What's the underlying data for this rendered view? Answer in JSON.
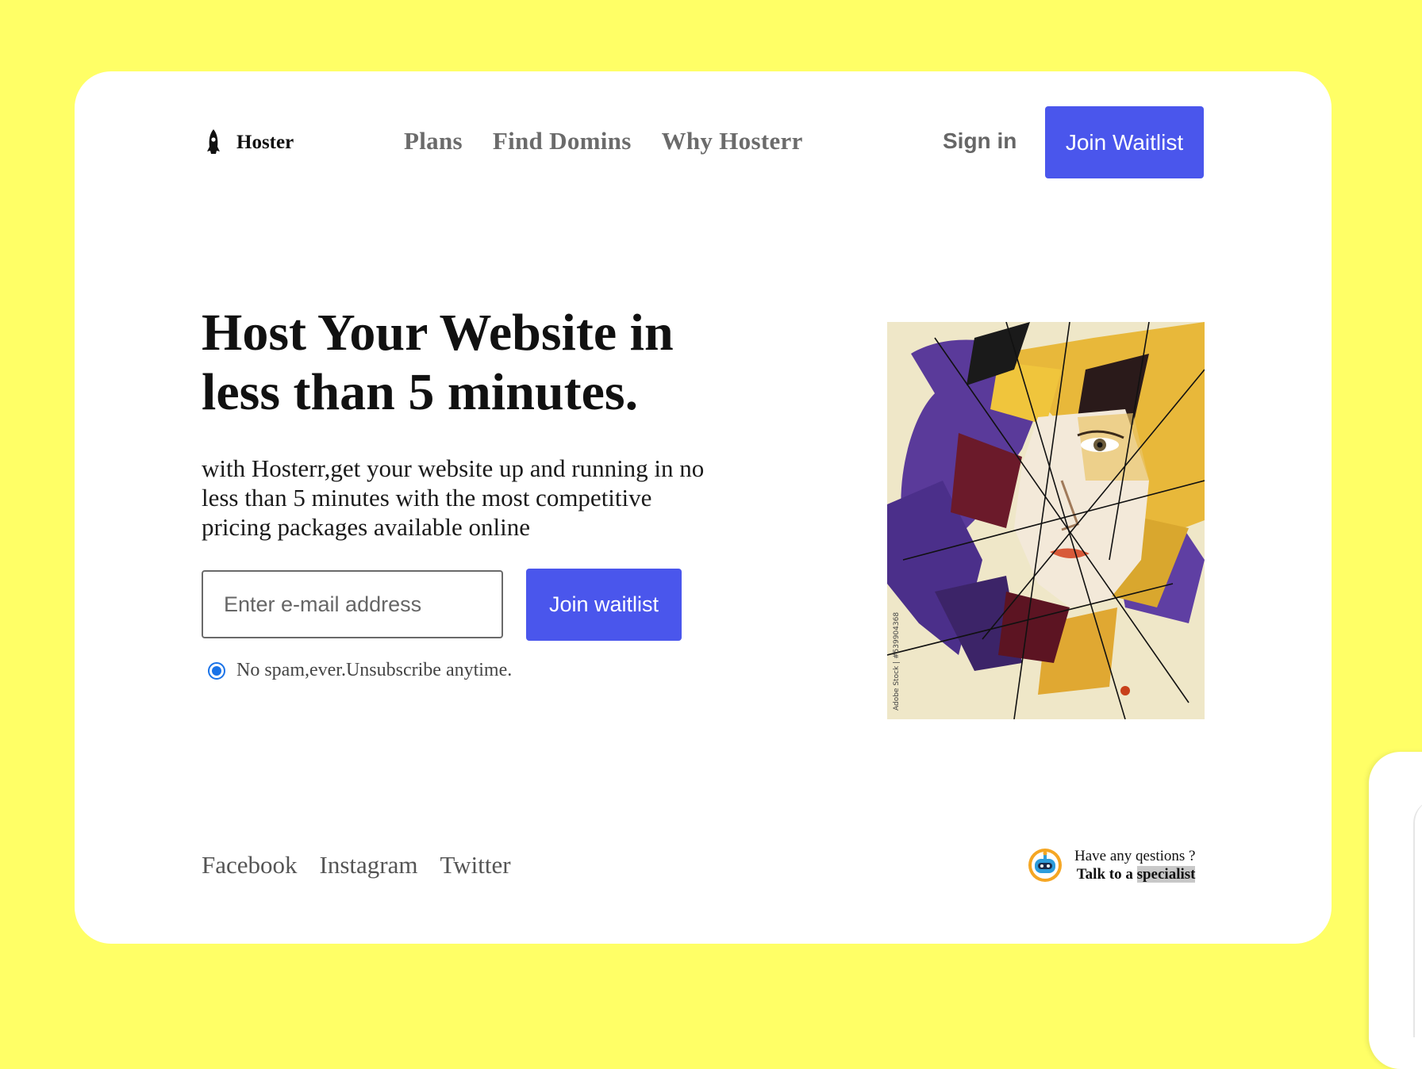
{
  "brand": {
    "name": "Hoster",
    "logo_icon": "rocket-icon"
  },
  "nav": {
    "items": [
      {
        "label": "Plans"
      },
      {
        "label": "Find Domins"
      },
      {
        "label": "Why Hosterr"
      }
    ],
    "sign_in": "Sign in",
    "join_waitlist": "Join Waitlist"
  },
  "hero": {
    "title": "Host Your Website in less than 5 minutes.",
    "subtitle": "with Hosterr,get your website up and running in no less than 5 minutes with the most competitive pricing packages available online",
    "email_placeholder": "Enter e-mail address",
    "email_value": "",
    "cta": "Join waitlist",
    "consent": "No spam,ever.Unsubscribe anytime.",
    "consent_checked": true,
    "artwork_watermark": "Adobe Stock | #539904368"
  },
  "footer": {
    "social": [
      {
        "label": "Facebook"
      },
      {
        "label": "Instagram"
      },
      {
        "label": "Twitter"
      }
    ],
    "help_question": "Have any qestions ?",
    "help_prefix": "Talk to a",
    "help_link": "specialist",
    "help_icon": "support-bot-icon"
  },
  "colors": {
    "background": "#ffff66",
    "primary": "#4a56ec",
    "card": "#ffffff"
  }
}
